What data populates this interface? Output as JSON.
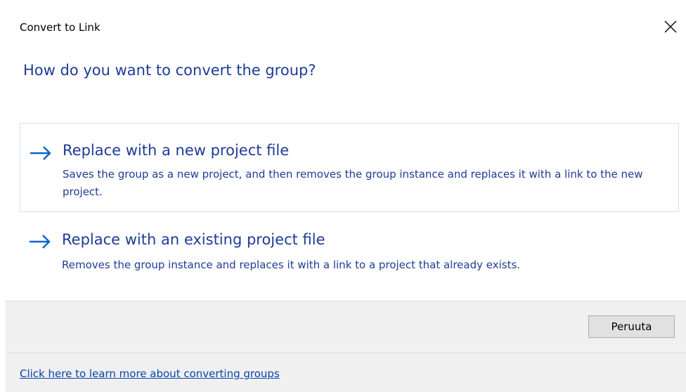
{
  "window": {
    "title": "Convert to Link",
    "close_glyph": "✕"
  },
  "main": {
    "instruction": "How do you want to convert the group?",
    "options": [
      {
        "title": "Replace with a new project file",
        "description": "Saves the group as a new project, and then removes the group instance and replaces it with a link to the new project.",
        "icon": "arrow-right-icon"
      },
      {
        "title": "Replace with an existing project file",
        "description": "Removes the group instance and replaces it with a link to a project that already exists.",
        "icon": "arrow-right-icon"
      }
    ]
  },
  "footer": {
    "cancel_label": "Peruuta"
  },
  "footnote": {
    "link_text": "Click here to learn more about converting groups"
  },
  "colors": {
    "instruction_text": "#1e3c96",
    "arrow": "#0a64c8",
    "footer_bg": "#f0f0f0",
    "link": "#0645ad"
  }
}
